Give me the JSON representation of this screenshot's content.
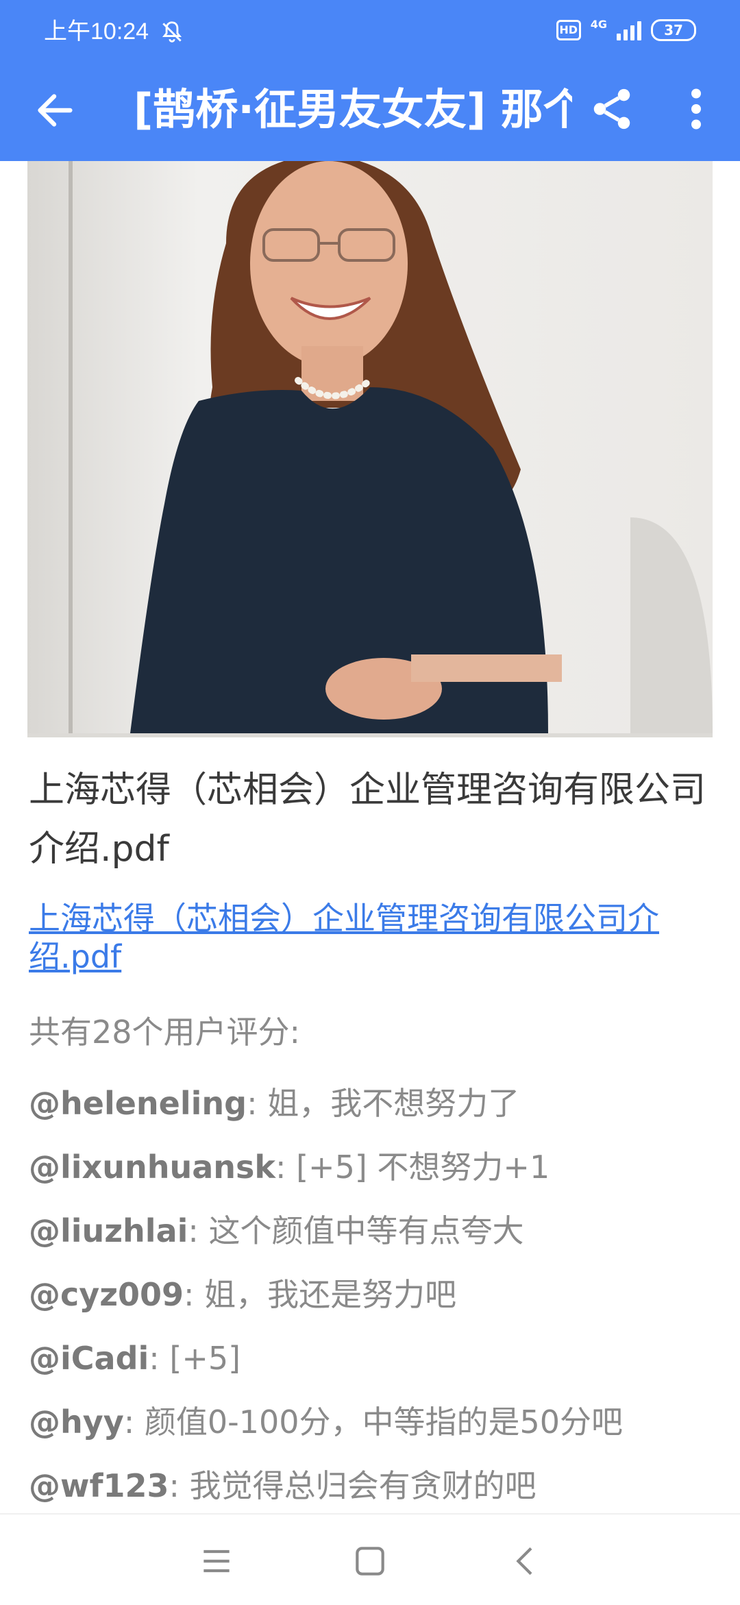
{
  "status_bar": {
    "time": "上午10:24",
    "hd": "HD",
    "network": "4G",
    "battery": "37"
  },
  "app_bar": {
    "title": "[鹊桥·征男友女友] 那个"
  },
  "content": {
    "doc_title": "上海芯得（芯相会）企业管理咨询有限公司介绍.pdf",
    "doc_link": "上海芯得（芯相会）企业管理咨询有限公司介绍.pdf",
    "rating_summary": "共有28个用户评分:",
    "comments": [
      {
        "user": "@heleneling",
        "text": ": 姐，我不想努力了"
      },
      {
        "user": "@lixunhuansk",
        "text": ": [+5] 不想努力+1"
      },
      {
        "user": "@liuzhlai",
        "text": ": 这个颜值中等有点夸大"
      },
      {
        "user": "@cyz009",
        "text": ": 姐，我还是努力吧"
      },
      {
        "user": "@iCadi",
        "text": ": [+5]"
      },
      {
        "user": "@hyy",
        "text": ": 颜值0-100分，中等指的是50分吧"
      },
      {
        "user": "@wf123",
        "text": ": 我觉得总归会有贪财的吧"
      }
    ]
  },
  "colors": {
    "brand": "#4a86f7",
    "link": "#3b7be8",
    "muted_text": "#8a8a8a"
  },
  "icons": {
    "status": [
      "bell-off-icon",
      "signal-icon",
      "battery-icon"
    ],
    "app_bar": [
      "back-arrow-icon",
      "share-icon",
      "more-vert-icon"
    ],
    "nav": [
      "menu-icon",
      "home-square-icon",
      "back-chevron-icon"
    ]
  }
}
